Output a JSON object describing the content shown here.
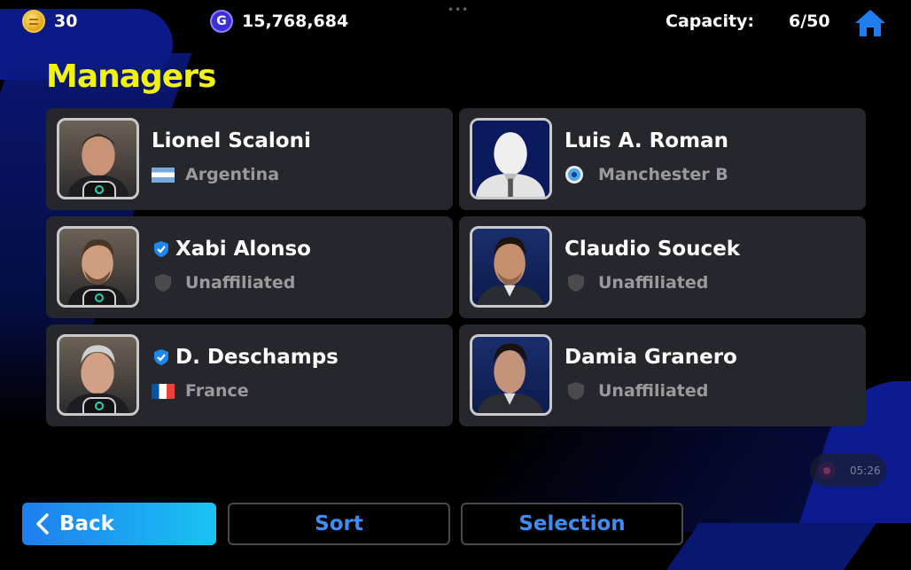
{
  "header": {
    "coins": "30",
    "gp": "15,768,684",
    "capacity_label": "Capacity:",
    "capacity_value": "6/50",
    "home_icon": "home-icon",
    "coin_icon": "coin-icon",
    "gp_icon": "gp-icon",
    "gp_icon_letter": "G"
  },
  "title": "Managers",
  "managers": [
    {
      "name": "Lionel Scaloni",
      "affiliation": "Argentina",
      "affiliation_icon": "argentina-flag-icon",
      "verified": false
    },
    {
      "name": "Luis A. Roman",
      "affiliation": "Manchester B",
      "affiliation_icon": "club-crest-icon",
      "verified": false
    },
    {
      "name": "Xabi Alonso",
      "affiliation": "Unaffiliated",
      "affiliation_icon": "shield-icon",
      "verified": true
    },
    {
      "name": "Claudio Soucek",
      "affiliation": "Unaffiliated",
      "affiliation_icon": "shield-icon",
      "verified": false
    },
    {
      "name": "D. Deschamps",
      "affiliation": "France",
      "affiliation_icon": "france-flag-icon",
      "verified": true
    },
    {
      "name": "Damia Granero",
      "affiliation": "Unaffiliated",
      "affiliation_icon": "shield-icon",
      "verified": false
    }
  ],
  "footer": {
    "back_label": "Back",
    "sort_label": "Sort",
    "selection_label": "Selection"
  },
  "recording": {
    "time": "05:26"
  },
  "colors": {
    "title": "#f2f210",
    "accent": "#3e8cf5",
    "card": "#26272d",
    "background": "#000000"
  }
}
